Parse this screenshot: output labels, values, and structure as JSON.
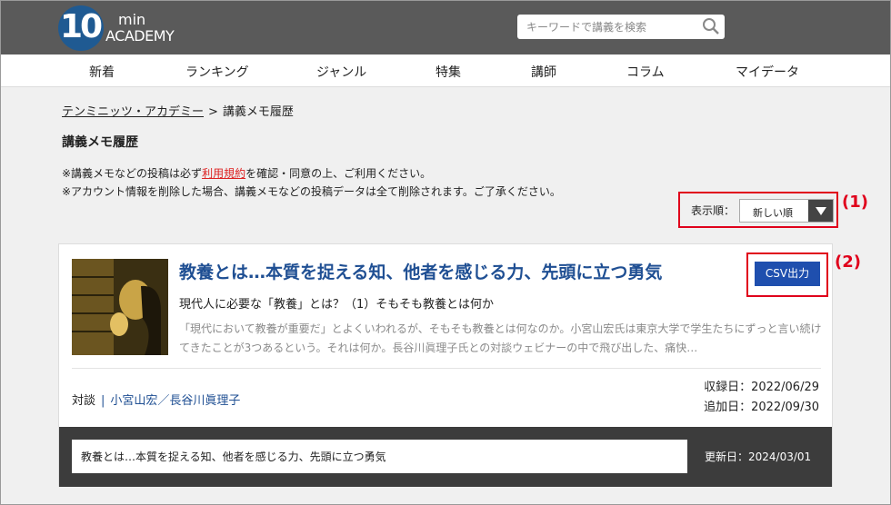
{
  "header": {
    "logo_number": "10",
    "logo_min": "min",
    "logo_academy": "ACADEMY",
    "search_placeholder": "キーワードで講義を検索"
  },
  "nav": [
    "新着",
    "ランキング",
    "ジャンル",
    "特集",
    "講師",
    "コラム",
    "マイデータ"
  ],
  "breadcrumb": {
    "home": "テンミニッツ・アカデミー",
    "separator": ">",
    "current": "講義メモ履歴"
  },
  "page_title": "講義メモ履歴",
  "notice": {
    "line1_prefix": "※講義メモなどの投稿は必ず",
    "line1_link": "利用規約",
    "line1_suffix": "を確認・同意の上、ご利用ください。",
    "line2": "※アカウント情報を削除した場合、講義メモなどの投稿データは全て削除されます。ご了承ください。"
  },
  "sort": {
    "label": "表示順：",
    "value": "新しい順"
  },
  "annotations": {
    "one": "(1)",
    "two": "(2)"
  },
  "lecture": {
    "title": "教養とは…本質を捉える知、他者を感じる力、先頭に立つ勇気",
    "subtitle": "現代人に必要な「教養」とは？（1）そもそも教養とは何か",
    "description": "「現代において教養が重要だ」とよくいわれるが、そもそも教養とは何なのか。小宮山宏氏は東京大学で学生たちにずっと言い続けてきたことが3つあるという。それは何か。長谷川眞理子氏との対談ウェビナーの中で飛び出した、痛快…",
    "csv_button": "CSV出力",
    "category": "対談",
    "meta_separator": "|",
    "lecturers": "小宮山宏／長谷川眞理子",
    "recorded": "収録日：2022/06/29",
    "added": "追加日：2022/09/30",
    "memo_text": "教養とは…本質を捉える知、他者を感じる力、先頭に立つ勇気",
    "updated": "更新日：2024/03/01"
  }
}
